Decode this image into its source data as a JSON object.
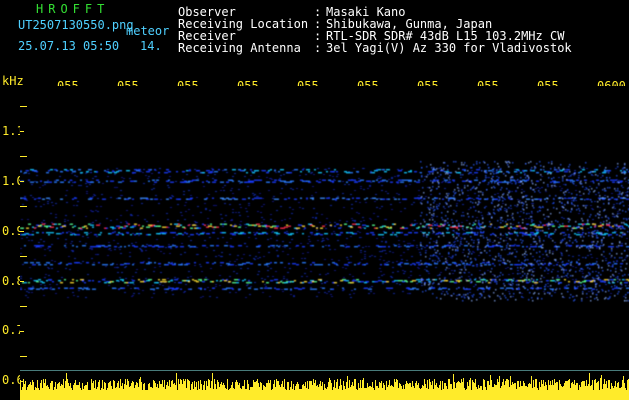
{
  "header": {
    "program": "HROFFT",
    "filename": "UT2507130550.png",
    "type": "meteor",
    "datetime": "25.07.13 05:50",
    "extra": "14.",
    "fields": [
      {
        "label": "Observer",
        "value": "Masaki Kano"
      },
      {
        "label": "Receiving Location",
        "value": "Shibukawa, Gunma, Japan"
      },
      {
        "label": "Receiver",
        "value": "RTL-SDR SDR# 43dB L15 103.2MHz CW"
      },
      {
        "label": "Receiving Antenna",
        "value": "3el Yagi(V) Az 330 for Vladivostok"
      }
    ]
  },
  "axis": {
    "unit": "kHz",
    "y_labels": [
      "1.1",
      "1.0",
      "0.9",
      "0.8",
      "0.7",
      "0.6"
    ],
    "y_values": [
      1.1,
      1.0,
      0.9,
      0.8,
      0.7,
      0.6
    ],
    "x_labels": [
      "055",
      "055",
      "055",
      "055",
      "055",
      "055",
      "055",
      "055",
      "055",
      "0600"
    ]
  },
  "colors": {
    "label": "#4fd0ff",
    "title": "#33e033",
    "noise": "#ffeb2a",
    "bg": "#000000"
  }
}
